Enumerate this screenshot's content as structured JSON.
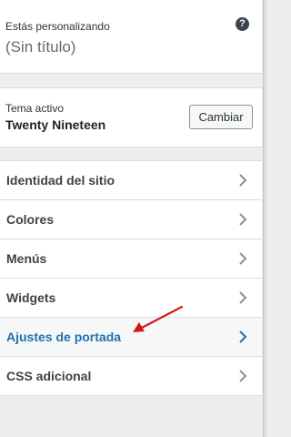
{
  "header": {
    "label": "Estás personalizando",
    "title": "(Sin título)",
    "help_icon": "question-circle-icon",
    "help_glyph": "?"
  },
  "theme": {
    "label": "Tema activo",
    "name": "Twenty Nineteen",
    "change_button": "Cambiar"
  },
  "menu": {
    "items": [
      {
        "label": "Identidad del sitio",
        "active": false
      },
      {
        "label": "Colores",
        "active": false
      },
      {
        "label": "Menús",
        "active": false
      },
      {
        "label": "Widgets",
        "active": false
      },
      {
        "label": "Ajustes de portada",
        "active": true
      },
      {
        "label": "CSS adicional",
        "active": false
      }
    ],
    "chevron_icon": "chevron-right-icon"
  },
  "annotation": {
    "arrow_color": "#d11a1a",
    "arrow_icon": "red-arrow-icon"
  },
  "colors": {
    "accent": "#2271b1",
    "text": "#3c434a"
  }
}
